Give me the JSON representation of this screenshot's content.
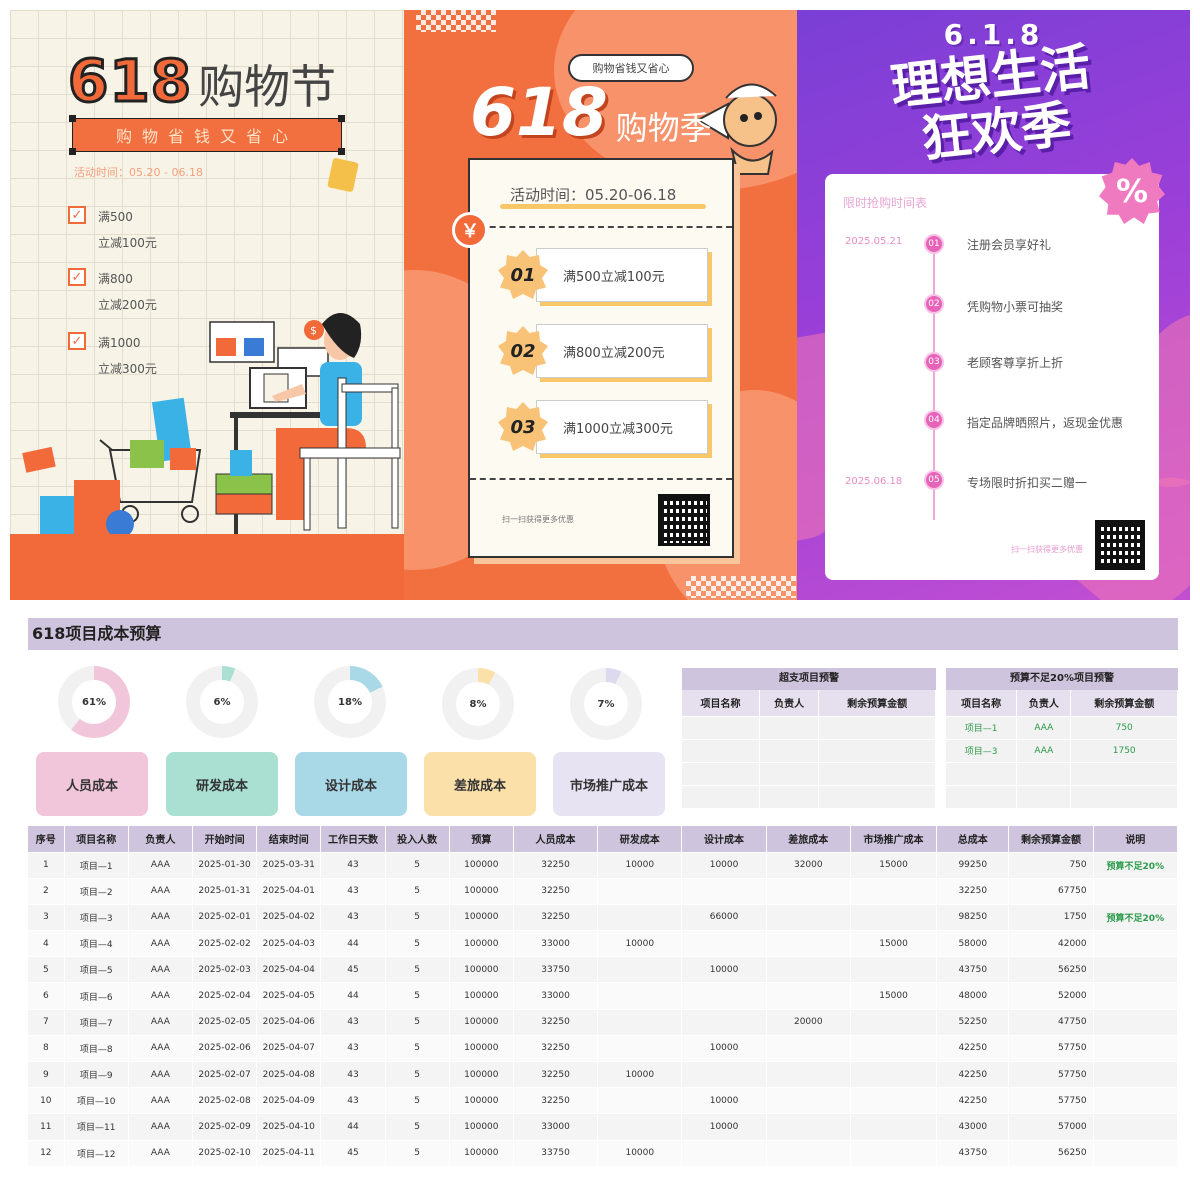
{
  "poster1": {
    "title_num": "618",
    "title_word": "购物节",
    "banner": "购物省钱又省心",
    "date": "活动时间：05.20 - 06.18",
    "items": [
      {
        "line1": "满500",
        "line2": "立减100元"
      },
      {
        "line1": "满800",
        "line2": "立减200元"
      },
      {
        "line1": "满1000",
        "line2": "立减300元"
      }
    ],
    "colors": {
      "accent": "#f26a3a",
      "bg": "#f7f3e6"
    }
  },
  "poster2": {
    "bubble": "购物省钱又省心",
    "title_num": "618",
    "title_word": "购物季",
    "date": "活动时间：05.20-06.18",
    "coupons": [
      {
        "num": "01",
        "text": "满500立减100元"
      },
      {
        "num": "02",
        "text": "满800立减200元"
      },
      {
        "num": "03",
        "text": "满1000立减300元"
      }
    ],
    "yen_icon": "￥",
    "scan": "扫一扫获得更多优惠",
    "colors": {
      "accent": "#f2703f"
    }
  },
  "poster3": {
    "title_top": "6.1.8",
    "title_line1": "理想生活",
    "title_line2": "狂欢季",
    "badge": "%",
    "card_title": "限时抢购时间表",
    "date_start": "2025.05.21",
    "date_end": "2025.06.18",
    "events": [
      {
        "num": "01",
        "text": "注册会员享好礼"
      },
      {
        "num": "02",
        "text": "凭购物小票可抽奖"
      },
      {
        "num": "03",
        "text": "老顾客尊享折上折"
      },
      {
        "num": "04",
        "text": "指定品牌晒照片，返现金优惠"
      },
      {
        "num": "05",
        "text": "专场限时折扣买二赠一"
      }
    ],
    "scan": "扫一扫获得更多优惠",
    "colors": {
      "bg": "#9a3fd8",
      "pink": "#e763b8"
    }
  },
  "sheet": {
    "title": "618项目成本预算",
    "rings": [
      {
        "label": "61%",
        "value": 61,
        "color": "#f1c6da"
      },
      {
        "label": "6%",
        "value": 6,
        "color": "#a9e0d2"
      },
      {
        "label": "18%",
        "value": 18,
        "color": "#a9d8e6"
      },
      {
        "label": "8%",
        "value": 8,
        "color": "#fbe0aa"
      },
      {
        "label": "7%",
        "value": 7,
        "color": "#ddd9ee"
      }
    ],
    "categories": [
      {
        "label": "人员成本",
        "color": "#f1c6da"
      },
      {
        "label": "研发成本",
        "color": "#a9e0d2"
      },
      {
        "label": "设计成本",
        "color": "#a9d8e6"
      },
      {
        "label": "差旅成本",
        "color": "#fbe0aa"
      },
      {
        "label": "市场推广成本",
        "color": "#e7e3f3"
      }
    ],
    "over_budget": {
      "title": "超支项目预警",
      "headers": [
        "项目名称",
        "负责人",
        "剩余预算金额"
      ],
      "rows": []
    },
    "low_budget": {
      "title": "预算不足20%项目预警",
      "headers": [
        "项目名称",
        "负责人",
        "剩余预算金额"
      ],
      "rows": [
        [
          "项目—1",
          "AAA",
          "750"
        ],
        [
          "项目—3",
          "AAA",
          "1750"
        ]
      ]
    },
    "table": {
      "headers": [
        "序号",
        "项目名称",
        "负责人",
        "开始时间",
        "结束时间",
        "工作日天数",
        "投入人数",
        "预算",
        "人员成本",
        "研发成本",
        "设计成本",
        "差旅成本",
        "市场推广成本",
        "总成本",
        "剩余预算金额",
        "说明"
      ],
      "rows": [
        [
          "1",
          "项目—1",
          "AAA",
          "2025-01-30",
          "2025-03-31",
          "43",
          "5",
          "100000",
          "32250",
          "10000",
          "10000",
          "32000",
          "15000",
          "99250",
          "750",
          "预算不足20%"
        ],
        [
          "2",
          "项目—2",
          "AAA",
          "2025-01-31",
          "2025-04-01",
          "43",
          "5",
          "100000",
          "32250",
          "",
          "",
          "",
          "",
          "32250",
          "67750",
          ""
        ],
        [
          "3",
          "项目—3",
          "AAA",
          "2025-02-01",
          "2025-04-02",
          "43",
          "5",
          "100000",
          "32250",
          "",
          "66000",
          "",
          "",
          "98250",
          "1750",
          "预算不足20%"
        ],
        [
          "4",
          "项目—4",
          "AAA",
          "2025-02-02",
          "2025-04-03",
          "44",
          "5",
          "100000",
          "33000",
          "10000",
          "",
          "",
          "15000",
          "58000",
          "42000",
          ""
        ],
        [
          "5",
          "项目—5",
          "AAA",
          "2025-02-03",
          "2025-04-04",
          "45",
          "5",
          "100000",
          "33750",
          "",
          "10000",
          "",
          "",
          "43750",
          "56250",
          ""
        ],
        [
          "6",
          "项目—6",
          "AAA",
          "2025-02-04",
          "2025-04-05",
          "44",
          "5",
          "100000",
          "33000",
          "",
          "",
          "",
          "15000",
          "48000",
          "52000",
          ""
        ],
        [
          "7",
          "项目—7",
          "AAA",
          "2025-02-05",
          "2025-04-06",
          "43",
          "5",
          "100000",
          "32250",
          "",
          "",
          "20000",
          "",
          "52250",
          "47750",
          ""
        ],
        [
          "8",
          "项目—8",
          "AAA",
          "2025-02-06",
          "2025-04-07",
          "43",
          "5",
          "100000",
          "32250",
          "",
          "10000",
          "",
          "",
          "42250",
          "57750",
          ""
        ],
        [
          "9",
          "项目—9",
          "AAA",
          "2025-02-07",
          "2025-04-08",
          "43",
          "5",
          "100000",
          "32250",
          "10000",
          "",
          "",
          "",
          "42250",
          "57750",
          ""
        ],
        [
          "10",
          "项目—10",
          "AAA",
          "2025-02-08",
          "2025-04-09",
          "43",
          "5",
          "100000",
          "32250",
          "",
          "10000",
          "",
          "",
          "42250",
          "57750",
          ""
        ],
        [
          "11",
          "项目—11",
          "AAA",
          "2025-02-09",
          "2025-04-10",
          "44",
          "5",
          "100000",
          "33000",
          "",
          "10000",
          "",
          "",
          "43000",
          "57000",
          ""
        ],
        [
          "12",
          "项目—12",
          "AAA",
          "2025-02-10",
          "2025-04-11",
          "45",
          "5",
          "100000",
          "33750",
          "10000",
          "",
          "",
          "",
          "43750",
          "56250",
          ""
        ]
      ]
    }
  }
}
